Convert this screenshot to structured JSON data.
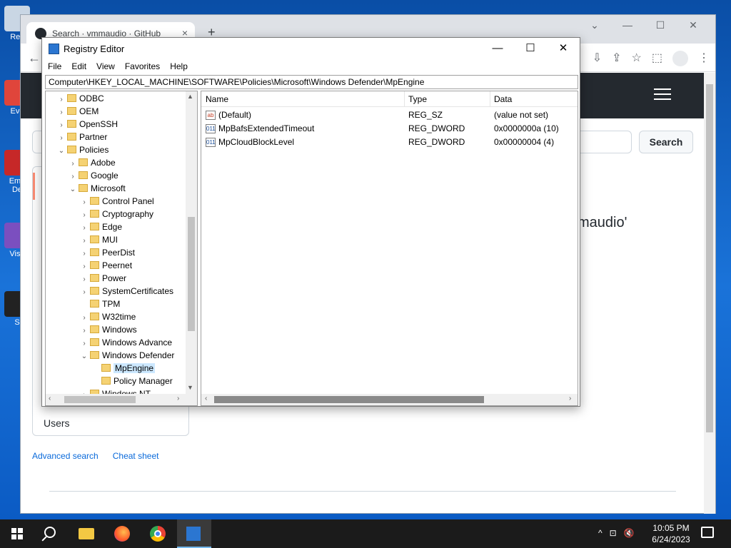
{
  "desktop": {
    "icons": [
      {
        "label": "Rec",
        "color": "#c9d6e4"
      },
      {
        "label": "Eve",
        "color": "#e0453b"
      },
      {
        "label": "Emb\nDe",
        "color": "#c62828"
      },
      {
        "label": "Visu",
        "color": "#7b4fbf"
      },
      {
        "label": "S",
        "color": "#222"
      }
    ]
  },
  "browser": {
    "tab_title": "Search · vmmaudio · GitHub",
    "tab_close": "×",
    "new_tab": "+",
    "window_controls": [
      "⌄",
      "—",
      "☐",
      "✕"
    ],
    "back": "←",
    "toolbar_icons": [
      "⇩",
      "⇪",
      "☆",
      "⬚"
    ],
    "search_button": "Search",
    "heading_fragment": "maudio'",
    "sidebar_users": "Users",
    "link_advanced": "Advanced search",
    "link_cheatsheet": "Cheat sheet"
  },
  "regedit": {
    "title": "Registry Editor",
    "controls": {
      "minimize": "—",
      "maximize": "☐",
      "close": "✕"
    },
    "menu": [
      "File",
      "Edit",
      "View",
      "Favorites",
      "Help"
    ],
    "address": "Computer\\HKEY_LOCAL_MACHINE\\SOFTWARE\\Policies\\Microsoft\\Windows Defender\\MpEngine",
    "tree": [
      {
        "label": "ODBC",
        "level": 0,
        "chev": "›"
      },
      {
        "label": "OEM",
        "level": 0,
        "chev": "›"
      },
      {
        "label": "OpenSSH",
        "level": 0,
        "chev": "›"
      },
      {
        "label": "Partner",
        "level": 0,
        "chev": "›"
      },
      {
        "label": "Policies",
        "level": 0,
        "chev": "⌄"
      },
      {
        "label": "Adobe",
        "level": 1,
        "chev": "›"
      },
      {
        "label": "Google",
        "level": 1,
        "chev": "›"
      },
      {
        "label": "Microsoft",
        "level": 1,
        "chev": "⌄"
      },
      {
        "label": "Control Panel",
        "level": 2,
        "chev": "›"
      },
      {
        "label": "Cryptography",
        "level": 2,
        "chev": "›"
      },
      {
        "label": "Edge",
        "level": 2,
        "chev": "›"
      },
      {
        "label": "MUI",
        "level": 2,
        "chev": "›"
      },
      {
        "label": "PeerDist",
        "level": 2,
        "chev": "›"
      },
      {
        "label": "Peernet",
        "level": 2,
        "chev": "›"
      },
      {
        "label": "Power",
        "level": 2,
        "chev": "›"
      },
      {
        "label": "SystemCertificates",
        "level": 2,
        "chev": "›"
      },
      {
        "label": "TPM",
        "level": 2,
        "chev": ""
      },
      {
        "label": "W32time",
        "level": 2,
        "chev": "›"
      },
      {
        "label": "Windows",
        "level": 2,
        "chev": "›"
      },
      {
        "label": "Windows Advance",
        "level": 2,
        "chev": "›"
      },
      {
        "label": "Windows Defender",
        "level": 2,
        "chev": "⌄"
      },
      {
        "label": "MpEngine",
        "level": 3,
        "chev": "",
        "selected": true
      },
      {
        "label": "Policy Manager",
        "level": 3,
        "chev": ""
      },
      {
        "label": "Windows NT",
        "level": 2,
        "chev": "›"
      }
    ],
    "columns": {
      "name": "Name",
      "type": "Type",
      "data": "Data"
    },
    "values": [
      {
        "icon": "ab",
        "name": "(Default)",
        "type": "REG_SZ",
        "data": "(value not set)"
      },
      {
        "icon": "011",
        "name": "MpBafsExtendedTimeout",
        "type": "REG_DWORD",
        "data": "0x0000000a (10)"
      },
      {
        "icon": "011",
        "name": "MpCloudBlockLevel",
        "type": "REG_DWORD",
        "data": "0x00000004 (4)"
      }
    ],
    "scroll_arrows": {
      "up": "▲",
      "down": "▼",
      "left": "‹",
      "right": "›"
    }
  },
  "taskbar": {
    "tray_icons": [
      "^",
      "⊡",
      "🔇"
    ],
    "time": "10:05 PM",
    "date": "6/24/2023"
  }
}
